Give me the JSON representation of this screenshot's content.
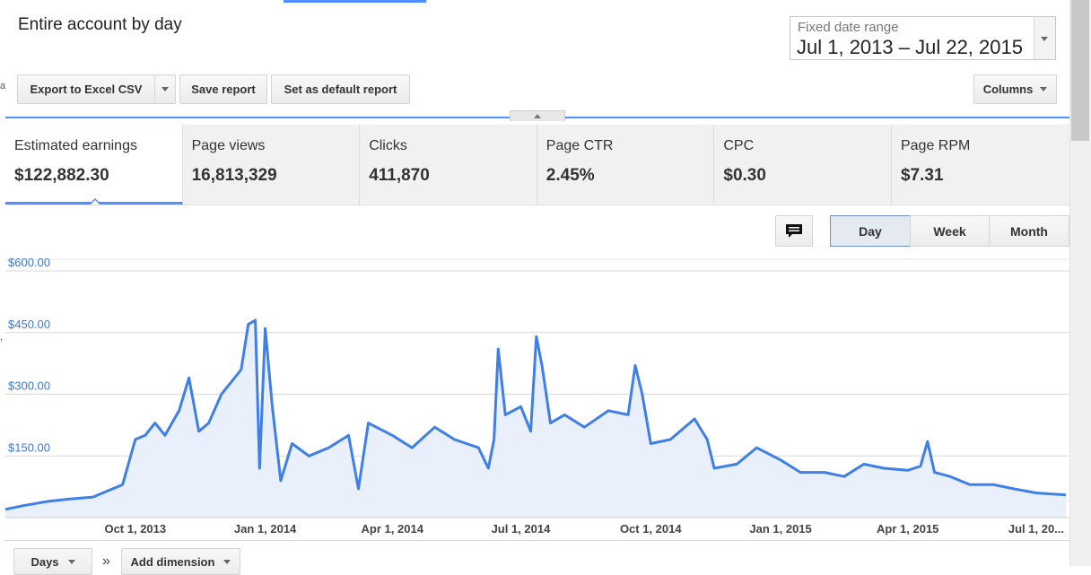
{
  "header": {
    "title": "Entire account by day",
    "date_range_label": "Fixed date range",
    "date_range_value": "Jul 1, 2013 – Jul 22, 2015"
  },
  "toolbar": {
    "export_label": "Export to Excel CSV",
    "save_label": "Save report",
    "default_label": "Set as default report",
    "columns_label": "Columns"
  },
  "metrics": [
    {
      "label": "Estimated earnings",
      "value": "$122,882.30"
    },
    {
      "label": "Page views",
      "value": "16,813,329"
    },
    {
      "label": "Clicks",
      "value": "411,870"
    },
    {
      "label": "Page CTR",
      "value": "2.45%"
    },
    {
      "label": "CPC",
      "value": "$0.30"
    },
    {
      "label": "Page RPM",
      "value": "$7.31"
    }
  ],
  "granularity": {
    "day": "Day",
    "week": "Week",
    "month": "Month",
    "selected": "Day"
  },
  "bottom": {
    "days_label": "Days",
    "separator": "»",
    "add_dimension_label": "Add dimension"
  },
  "colors": {
    "accent": "#4d90fe",
    "line": "#3f7fe8",
    "fill": "#e9f0fc",
    "tick_text": "#3a78d8"
  },
  "chart_data": {
    "type": "area",
    "y_ticks": [
      "$600.00",
      "$450.00",
      "$300.00",
      "$150.00"
    ],
    "y_tick_values": [
      600,
      450,
      300,
      150
    ],
    "ylim": [
      0,
      600
    ],
    "x_ticks": [
      "Oct 1, 2013",
      "Jan 1, 2014",
      "Apr 1, 2014",
      "Jul 1, 2014",
      "Oct 1, 2014",
      "Jan 1, 2015",
      "Apr 1, 2015",
      "Jul 1, 20..."
    ],
    "x_tick_dates": [
      "2013-10-01",
      "2014-01-01",
      "2014-04-01",
      "2014-07-01",
      "2014-10-01",
      "2015-01-01",
      "2015-04-01",
      "2015-07-01"
    ],
    "x_range": [
      "2013-07-01",
      "2015-07-22"
    ],
    "grid": true,
    "series": [
      {
        "points": [
          [
            "2013-07-01",
            20
          ],
          [
            "2013-07-15",
            30
          ],
          [
            "2013-08-01",
            40
          ],
          [
            "2013-08-15",
            45
          ],
          [
            "2013-09-01",
            50
          ],
          [
            "2013-09-15",
            70
          ],
          [
            "2013-09-22",
            80
          ],
          [
            "2013-10-01",
            190
          ],
          [
            "2013-10-08",
            200
          ],
          [
            "2013-10-15",
            230
          ],
          [
            "2013-10-22",
            200
          ],
          [
            "2013-11-01",
            260
          ],
          [
            "2013-11-08",
            340
          ],
          [
            "2013-11-15",
            210
          ],
          [
            "2013-11-22",
            230
          ],
          [
            "2013-12-01",
            300
          ],
          [
            "2013-12-08",
            330
          ],
          [
            "2013-12-15",
            360
          ],
          [
            "2013-12-20",
            470
          ],
          [
            "2013-12-25",
            480
          ],
          [
            "2013-12-28",
            120
          ],
          [
            "2014-01-01",
            460
          ],
          [
            "2014-01-06",
            270
          ],
          [
            "2014-01-12",
            90
          ],
          [
            "2014-01-20",
            180
          ],
          [
            "2014-02-01",
            150
          ],
          [
            "2014-02-15",
            170
          ],
          [
            "2014-03-01",
            200
          ],
          [
            "2014-03-08",
            70
          ],
          [
            "2014-03-15",
            230
          ],
          [
            "2014-04-01",
            200
          ],
          [
            "2014-04-15",
            170
          ],
          [
            "2014-05-01",
            220
          ],
          [
            "2014-05-15",
            190
          ],
          [
            "2014-06-01",
            170
          ],
          [
            "2014-06-08",
            120
          ],
          [
            "2014-06-12",
            190
          ],
          [
            "2014-06-15",
            410
          ],
          [
            "2014-06-20",
            250
          ],
          [
            "2014-07-01",
            270
          ],
          [
            "2014-07-08",
            210
          ],
          [
            "2014-07-12",
            440
          ],
          [
            "2014-07-16",
            370
          ],
          [
            "2014-07-22",
            230
          ],
          [
            "2014-08-01",
            250
          ],
          [
            "2014-08-15",
            220
          ],
          [
            "2014-09-01",
            260
          ],
          [
            "2014-09-15",
            250
          ],
          [
            "2014-09-20",
            370
          ],
          [
            "2014-09-25",
            300
          ],
          [
            "2014-10-01",
            180
          ],
          [
            "2014-10-15",
            190
          ],
          [
            "2014-11-01",
            240
          ],
          [
            "2014-11-10",
            190
          ],
          [
            "2014-11-15",
            120
          ],
          [
            "2014-12-01",
            130
          ],
          [
            "2014-12-15",
            170
          ],
          [
            "2015-01-01",
            140
          ],
          [
            "2015-01-15",
            110
          ],
          [
            "2015-02-01",
            110
          ],
          [
            "2015-02-15",
            100
          ],
          [
            "2015-03-01",
            130
          ],
          [
            "2015-03-15",
            120
          ],
          [
            "2015-04-01",
            115
          ],
          [
            "2015-04-10",
            125
          ],
          [
            "2015-04-15",
            185
          ],
          [
            "2015-04-20",
            110
          ],
          [
            "2015-05-01",
            100
          ],
          [
            "2015-05-15",
            80
          ],
          [
            "2015-06-01",
            80
          ],
          [
            "2015-06-15",
            70
          ],
          [
            "2015-07-01",
            60
          ],
          [
            "2015-07-22",
            55
          ]
        ]
      }
    ]
  }
}
